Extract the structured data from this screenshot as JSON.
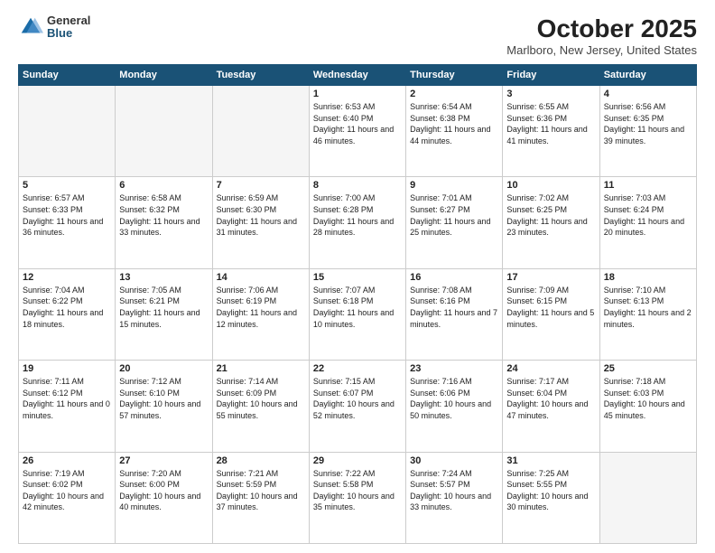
{
  "header": {
    "logo_general": "General",
    "logo_blue": "Blue",
    "title": "October 2025",
    "location": "Marlboro, New Jersey, United States"
  },
  "weekdays": [
    "Sunday",
    "Monday",
    "Tuesday",
    "Wednesday",
    "Thursday",
    "Friday",
    "Saturday"
  ],
  "weeks": [
    [
      {
        "day": "",
        "info": ""
      },
      {
        "day": "",
        "info": ""
      },
      {
        "day": "",
        "info": ""
      },
      {
        "day": "1",
        "info": "Sunrise: 6:53 AM\nSunset: 6:40 PM\nDaylight: 11 hours\nand 46 minutes."
      },
      {
        "day": "2",
        "info": "Sunrise: 6:54 AM\nSunset: 6:38 PM\nDaylight: 11 hours\nand 44 minutes."
      },
      {
        "day": "3",
        "info": "Sunrise: 6:55 AM\nSunset: 6:36 PM\nDaylight: 11 hours\nand 41 minutes."
      },
      {
        "day": "4",
        "info": "Sunrise: 6:56 AM\nSunset: 6:35 PM\nDaylight: 11 hours\nand 39 minutes."
      }
    ],
    [
      {
        "day": "5",
        "info": "Sunrise: 6:57 AM\nSunset: 6:33 PM\nDaylight: 11 hours\nand 36 minutes."
      },
      {
        "day": "6",
        "info": "Sunrise: 6:58 AM\nSunset: 6:32 PM\nDaylight: 11 hours\nand 33 minutes."
      },
      {
        "day": "7",
        "info": "Sunrise: 6:59 AM\nSunset: 6:30 PM\nDaylight: 11 hours\nand 31 minutes."
      },
      {
        "day": "8",
        "info": "Sunrise: 7:00 AM\nSunset: 6:28 PM\nDaylight: 11 hours\nand 28 minutes."
      },
      {
        "day": "9",
        "info": "Sunrise: 7:01 AM\nSunset: 6:27 PM\nDaylight: 11 hours\nand 25 minutes."
      },
      {
        "day": "10",
        "info": "Sunrise: 7:02 AM\nSunset: 6:25 PM\nDaylight: 11 hours\nand 23 minutes."
      },
      {
        "day": "11",
        "info": "Sunrise: 7:03 AM\nSunset: 6:24 PM\nDaylight: 11 hours\nand 20 minutes."
      }
    ],
    [
      {
        "day": "12",
        "info": "Sunrise: 7:04 AM\nSunset: 6:22 PM\nDaylight: 11 hours\nand 18 minutes."
      },
      {
        "day": "13",
        "info": "Sunrise: 7:05 AM\nSunset: 6:21 PM\nDaylight: 11 hours\nand 15 minutes."
      },
      {
        "day": "14",
        "info": "Sunrise: 7:06 AM\nSunset: 6:19 PM\nDaylight: 11 hours\nand 12 minutes."
      },
      {
        "day": "15",
        "info": "Sunrise: 7:07 AM\nSunset: 6:18 PM\nDaylight: 11 hours\nand 10 minutes."
      },
      {
        "day": "16",
        "info": "Sunrise: 7:08 AM\nSunset: 6:16 PM\nDaylight: 11 hours\nand 7 minutes."
      },
      {
        "day": "17",
        "info": "Sunrise: 7:09 AM\nSunset: 6:15 PM\nDaylight: 11 hours\nand 5 minutes."
      },
      {
        "day": "18",
        "info": "Sunrise: 7:10 AM\nSunset: 6:13 PM\nDaylight: 11 hours\nand 2 minutes."
      }
    ],
    [
      {
        "day": "19",
        "info": "Sunrise: 7:11 AM\nSunset: 6:12 PM\nDaylight: 11 hours\nand 0 minutes."
      },
      {
        "day": "20",
        "info": "Sunrise: 7:12 AM\nSunset: 6:10 PM\nDaylight: 10 hours\nand 57 minutes."
      },
      {
        "day": "21",
        "info": "Sunrise: 7:14 AM\nSunset: 6:09 PM\nDaylight: 10 hours\nand 55 minutes."
      },
      {
        "day": "22",
        "info": "Sunrise: 7:15 AM\nSunset: 6:07 PM\nDaylight: 10 hours\nand 52 minutes."
      },
      {
        "day": "23",
        "info": "Sunrise: 7:16 AM\nSunset: 6:06 PM\nDaylight: 10 hours\nand 50 minutes."
      },
      {
        "day": "24",
        "info": "Sunrise: 7:17 AM\nSunset: 6:04 PM\nDaylight: 10 hours\nand 47 minutes."
      },
      {
        "day": "25",
        "info": "Sunrise: 7:18 AM\nSunset: 6:03 PM\nDaylight: 10 hours\nand 45 minutes."
      }
    ],
    [
      {
        "day": "26",
        "info": "Sunrise: 7:19 AM\nSunset: 6:02 PM\nDaylight: 10 hours\nand 42 minutes."
      },
      {
        "day": "27",
        "info": "Sunrise: 7:20 AM\nSunset: 6:00 PM\nDaylight: 10 hours\nand 40 minutes."
      },
      {
        "day": "28",
        "info": "Sunrise: 7:21 AM\nSunset: 5:59 PM\nDaylight: 10 hours\nand 37 minutes."
      },
      {
        "day": "29",
        "info": "Sunrise: 7:22 AM\nSunset: 5:58 PM\nDaylight: 10 hours\nand 35 minutes."
      },
      {
        "day": "30",
        "info": "Sunrise: 7:24 AM\nSunset: 5:57 PM\nDaylight: 10 hours\nand 33 minutes."
      },
      {
        "day": "31",
        "info": "Sunrise: 7:25 AM\nSunset: 5:55 PM\nDaylight: 10 hours\nand 30 minutes."
      },
      {
        "day": "",
        "info": ""
      }
    ]
  ]
}
